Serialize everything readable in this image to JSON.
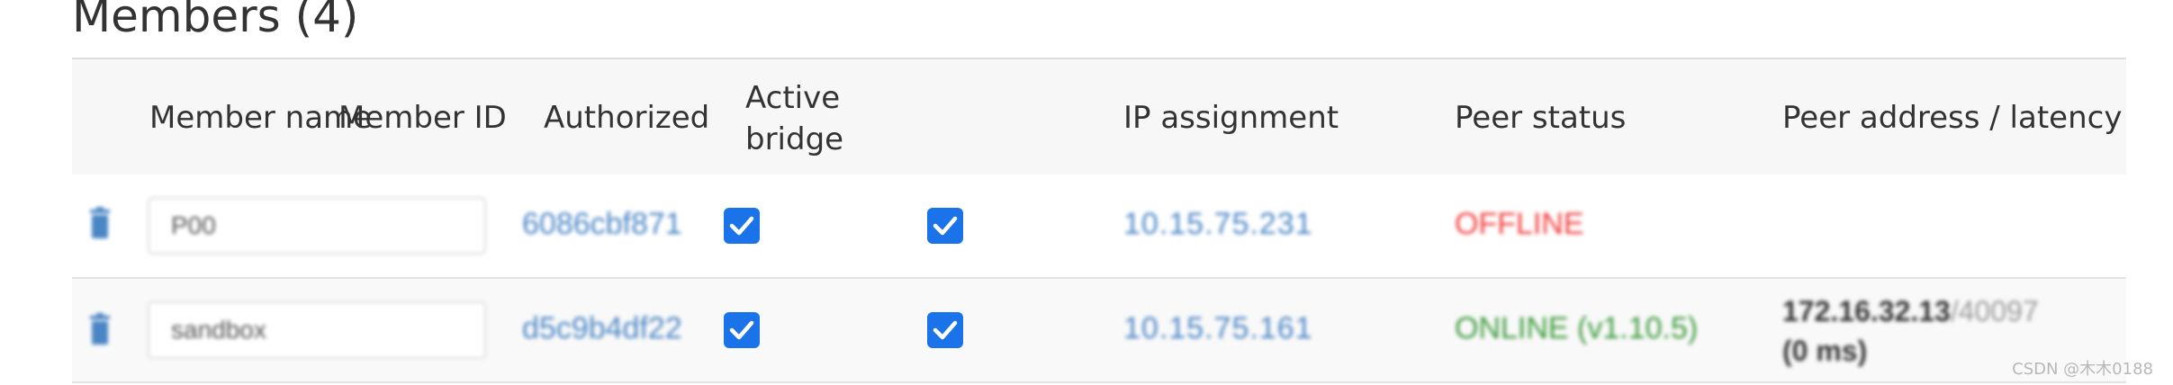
{
  "section": {
    "title": "Members (4)"
  },
  "table": {
    "columns": {
      "name": "Member name",
      "id": "Member ID",
      "authorized": "Authorized",
      "bridge_line1": "Active",
      "bridge_line2": "bridge",
      "ip": "IP assignment",
      "status": "Peer status",
      "peer": "Peer address / latency"
    },
    "rows": [
      {
        "name_value": "P00",
        "member_id": "6086cbf871",
        "authorized": true,
        "active_bridge": true,
        "ip": "10.15.75.231",
        "status": "OFFLINE",
        "status_color": "#f13d3d",
        "peer_address": "",
        "peer_port": "",
        "latency": ""
      },
      {
        "name_value": "sandbox",
        "member_id": "d5c9b4df22",
        "authorized": true,
        "active_bridge": true,
        "ip": "10.15.75.161",
        "status": "ONLINE (v1.10.5)",
        "status_color": "#3a9a3a",
        "peer_address": "172.16.32.13",
        "peer_port": "/40097",
        "latency": "(0 ms)"
      }
    ]
  },
  "icons": {
    "delete": "trash-icon",
    "check": "checkmark-icon"
  },
  "colors": {
    "link": "#4a86c5",
    "checkbox": "#1a73e8",
    "offline": "#f13d3d",
    "online": "#3a9a3a"
  },
  "watermark": "CSDN @木木0188"
}
